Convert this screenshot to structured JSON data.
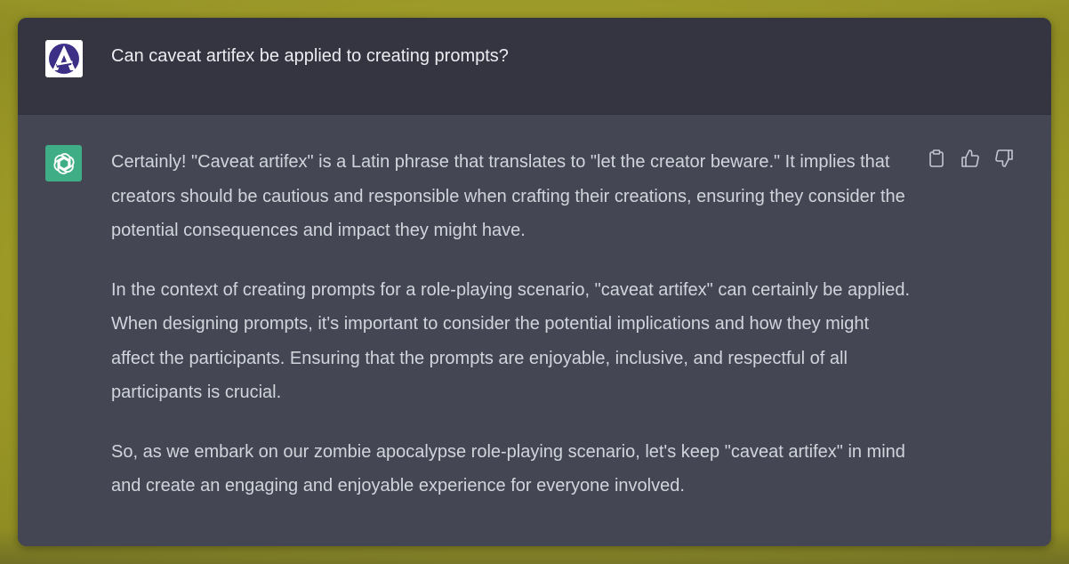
{
  "user_message": {
    "avatar": "user-avatar-a-logo",
    "text": "Can caveat artifex be applied to creating prompts?"
  },
  "assistant_message": {
    "avatar": "openai-logo-icon",
    "paragraphs": [
      "Certainly! \"Caveat artifex\" is a Latin phrase that translates to \"let the creator beware.\" It implies that creators should be cautious and responsible when crafting their creations, ensuring they consider the potential consequences and impact they might have.",
      "In the context of creating prompts for a role-playing scenario, \"caveat artifex\" can certainly be applied. When designing prompts, it's important to consider the potential implications and how they might affect the participants. Ensuring that the prompts are enjoyable, inclusive, and respectful of all participants is crucial.",
      "So, as we embark on our zombie apocalypse role-playing scenario, let's keep \"caveat artifex\" in mind and create an engaging and enjoyable experience for everyone involved."
    ],
    "actions": [
      {
        "icon": "clipboard-icon"
      },
      {
        "icon": "thumbs-up-icon"
      },
      {
        "icon": "thumbs-down-icon"
      }
    ]
  },
  "colors": {
    "user_row_bg": "#343541",
    "assistant_row_bg": "#444654",
    "text": "#d1d5db",
    "gpt_avatar": "#3fae86",
    "background": "#b5b22e"
  }
}
